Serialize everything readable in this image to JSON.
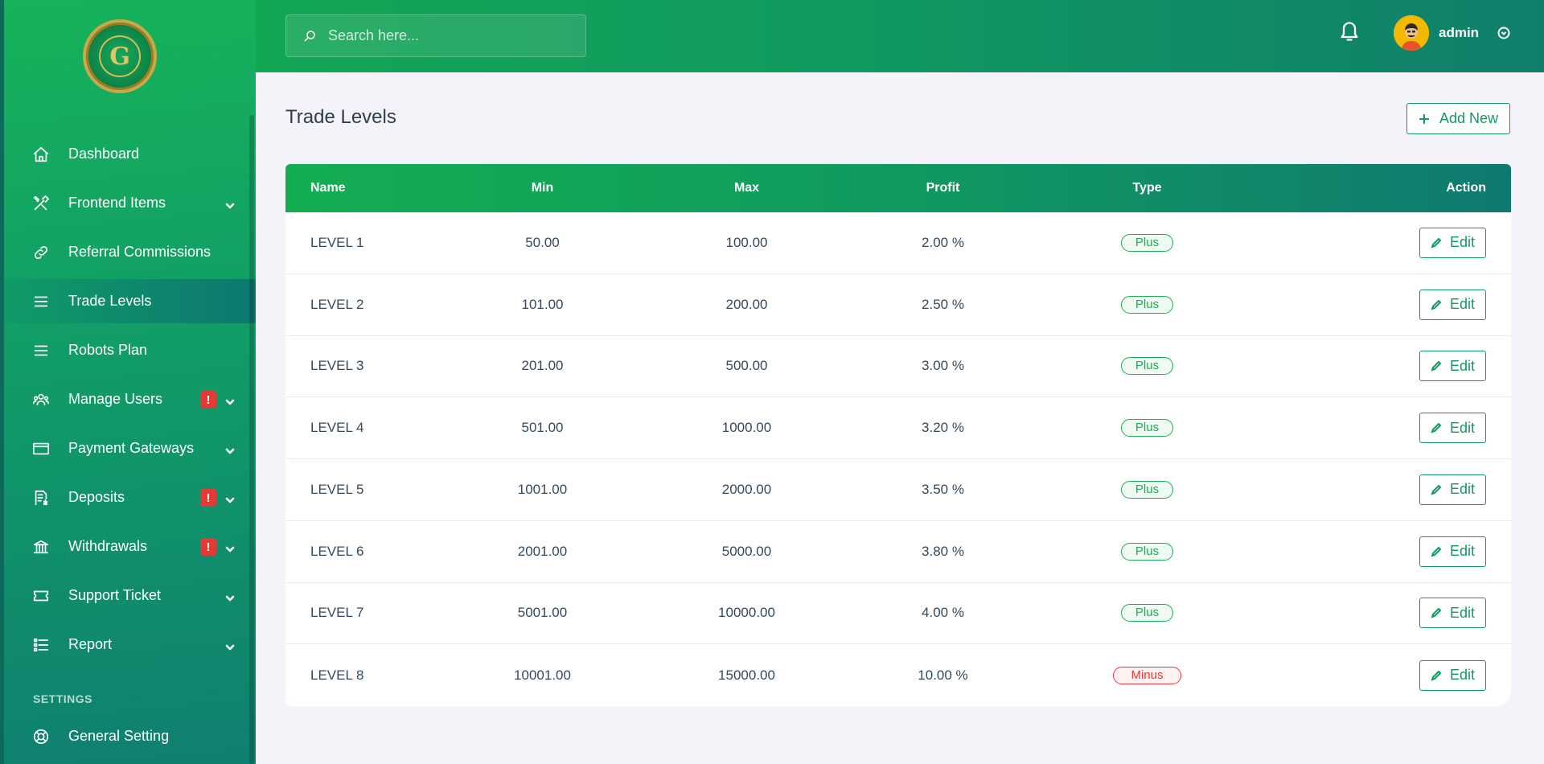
{
  "sidebar": {
    "items": [
      {
        "label": "Dashboard",
        "icon": "home-icon"
      },
      {
        "label": "Frontend Items",
        "icon": "tools-icon"
      },
      {
        "label": "Referral Commissions",
        "icon": "link-icon"
      },
      {
        "label": "Trade Levels",
        "icon": "menu-icon"
      },
      {
        "label": "Robots Plan",
        "icon": "menu-icon"
      },
      {
        "label": "Manage Users",
        "icon": "users-icon",
        "badge": "!"
      },
      {
        "label": "Payment Gateways",
        "icon": "credit-card-icon"
      },
      {
        "label": "Deposits",
        "icon": "invoice-icon",
        "badge": "!"
      },
      {
        "label": "Withdrawals",
        "icon": "bank-icon",
        "badge": "!"
      },
      {
        "label": "Support Ticket",
        "icon": "ticket-icon"
      },
      {
        "label": "Report",
        "icon": "list-icon"
      }
    ],
    "settings_label": "SETTINGS",
    "settings_items": [
      {
        "label": "General Setting",
        "icon": "lifebuoy-icon"
      }
    ]
  },
  "header": {
    "search_placeholder": "Search here...",
    "user_name": "admin"
  },
  "main": {
    "title": "Trade Levels",
    "add_button": "Add New",
    "columns": [
      "Name",
      "Min",
      "Max",
      "Profit",
      "Type",
      "Action"
    ],
    "rows": [
      {
        "name": "LEVEL 1",
        "min": "50.00",
        "max": "100.00",
        "profit": "2.00 %",
        "type": "Plus"
      },
      {
        "name": "LEVEL 2",
        "min": "101.00",
        "max": "200.00",
        "profit": "2.50 %",
        "type": "Plus"
      },
      {
        "name": "LEVEL 3",
        "min": "201.00",
        "max": "500.00",
        "profit": "3.00 %",
        "type": "Plus"
      },
      {
        "name": "LEVEL 4",
        "min": "501.00",
        "max": "1000.00",
        "profit": "3.20 %",
        "type": "Plus"
      },
      {
        "name": "LEVEL 5",
        "min": "1001.00",
        "max": "2000.00",
        "profit": "3.50 %",
        "type": "Plus"
      },
      {
        "name": "LEVEL 6",
        "min": "2001.00",
        "max": "5000.00",
        "profit": "3.80 %",
        "type": "Plus"
      },
      {
        "name": "LEVEL 7",
        "min": "5001.00",
        "max": "10000.00",
        "profit": "4.00 %",
        "type": "Plus"
      },
      {
        "name": "LEVEL 8",
        "min": "10001.00",
        "max": "15000.00",
        "profit": "10.00 %",
        "type": "Minus"
      }
    ],
    "edit_label": "Edit"
  },
  "colors": {
    "brand_green": "#119a60",
    "brand_teal": "#0f7a70",
    "plus": "#1aae55",
    "minus": "#e53935"
  }
}
